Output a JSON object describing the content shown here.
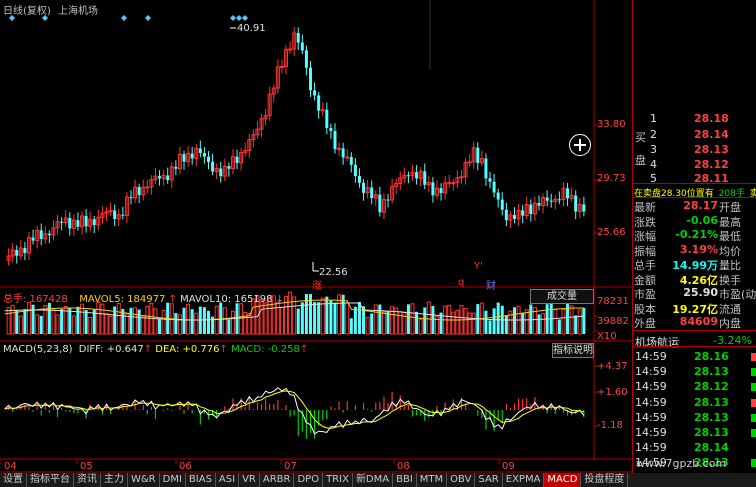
{
  "title": {
    "mode": "日线(复权)",
    "stock": "上海机场"
  },
  "price_axis": [
    {
      "label": "33.80",
      "value": 33.8
    },
    {
      "label": "29.73",
      "value": 29.73
    },
    {
      "label": "25.66",
      "value": 25.66
    }
  ],
  "annotations": {
    "high": "40.91",
    "low": "22.56",
    "mark_zhang": "涨",
    "mark_q": "q",
    "mark_cai": "财",
    "mark_y": "Y'"
  },
  "volume": {
    "total_label": "总手: 167428",
    "mavol5_label": "MAVOL5: 184977",
    "mavol10_label": "MAVOL10: 165198",
    "button": "成交量",
    "axis_top": "78231",
    "axis_mid": "39882",
    "axis_bottom": "X10"
  },
  "macd": {
    "title": "MACD(5,23,8)",
    "diff_label": "DIFF: +0.647",
    "dea_label": "DEA: +0.776",
    "macd_label": "MACD: -0.258",
    "button": "指标说明",
    "axis_top": "+4.37",
    "axis_mid": "+1.60",
    "axis_bottom": "-1.18"
  },
  "months": [
    "04",
    "05",
    "06",
    "07",
    "08",
    "09"
  ],
  "quote": {
    "buy_label": [
      "买",
      "盘"
    ],
    "bids": [
      {
        "level": "1",
        "price": "28.18"
      },
      {
        "level": "2",
        "price": "28.14"
      },
      {
        "level": "3",
        "price": "28.13"
      },
      {
        "level": "4",
        "price": "28.12"
      },
      {
        "level": "5",
        "price": "28.11"
      }
    ],
    "sell_line": {
      "a": "在卖盘28.30位置有",
      "b": "208手",
      "c": "卖"
    },
    "fields": [
      {
        "label": "最新",
        "value": "28.17",
        "suffix": "开盘"
      },
      {
        "label": "涨跌",
        "value": "-0.06",
        "suffix": "最高"
      },
      {
        "label": "涨幅",
        "value": "-0.21%",
        "suffix": "最低"
      },
      {
        "label": "振幅",
        "value": "3.19%",
        "suffix": "均价"
      },
      {
        "label": "总手",
        "value": "14.99万",
        "suffix": "量比"
      },
      {
        "label": "金额",
        "value": "4.26亿",
        "suffix": "换手"
      },
      {
        "label": "市盈",
        "value": "25.90",
        "suffix": "市盈(动)"
      },
      {
        "label": "股本",
        "value": "19.27亿",
        "suffix": "流通"
      },
      {
        "label": "外盘",
        "value": "84609",
        "suffix": "内盘"
      }
    ],
    "ticker_name": "机场航运",
    "ticker_change": "-3.24%",
    "ticks": [
      {
        "time": "14:59",
        "price": "28.16"
      },
      {
        "time": "14:59",
        "price": "28.13"
      },
      {
        "time": "14:59",
        "price": "28.12"
      },
      {
        "time": "14:59",
        "price": "28.13"
      },
      {
        "time": "14:59",
        "price": "28.13"
      },
      {
        "time": "14:59",
        "price": "28.13"
      },
      {
        "time": "14:59",
        "price": "28.14"
      },
      {
        "time": "14:59",
        "price": "28.13"
      }
    ]
  },
  "tabs": [
    "设置",
    "指标平台",
    "资讯",
    "主力",
    "W&R",
    "DMI",
    "BIAS",
    "ASI",
    "VR",
    "ARBR",
    "DPO",
    "TRIX",
    "新DMA",
    "BBI",
    "MTM",
    "OBV",
    "SAR",
    "EXPMA",
    "MACD",
    "投盘程度"
  ],
  "active_tab": "MACD",
  "watermark": "www.7gpzb.com",
  "colors": {
    "up": "#ff3232",
    "down": "#54ffff",
    "frame": "#b00000",
    "diff": "#ffffff",
    "dea": "#ffff00",
    "macd_pos": "#ff3232",
    "macd_neg": "#00d000"
  },
  "chart_data": [
    {
      "type": "candlestick",
      "title": "上海机场 日线(复权)",
      "x": [
        "04",
        "05",
        "06",
        "07",
        "08",
        "09"
      ],
      "high": 40.91,
      "low": 22.56,
      "last": 28.17,
      "y_ticks": [
        33.8,
        29.73,
        25.66
      ]
    },
    {
      "type": "bar",
      "title": "成交量",
      "series": [
        {
          "name": "总手",
          "values": [
            167428
          ]
        },
        {
          "name": "MAVOL5",
          "values": [
            184977
          ]
        },
        {
          "name": "MAVOL10",
          "values": [
            165198
          ]
        }
      ],
      "y_ticks": [
        78231,
        39882
      ]
    },
    {
      "type": "line",
      "title": "MACD(5,23,8)",
      "series": [
        {
          "name": "DIFF",
          "values": [
            0.647
          ]
        },
        {
          "name": "DEA",
          "values": [
            0.776
          ]
        },
        {
          "name": "MACD",
          "values": [
            -0.258
          ]
        }
      ],
      "y_ticks": [
        4.37,
        1.6,
        -1.18
      ]
    }
  ]
}
